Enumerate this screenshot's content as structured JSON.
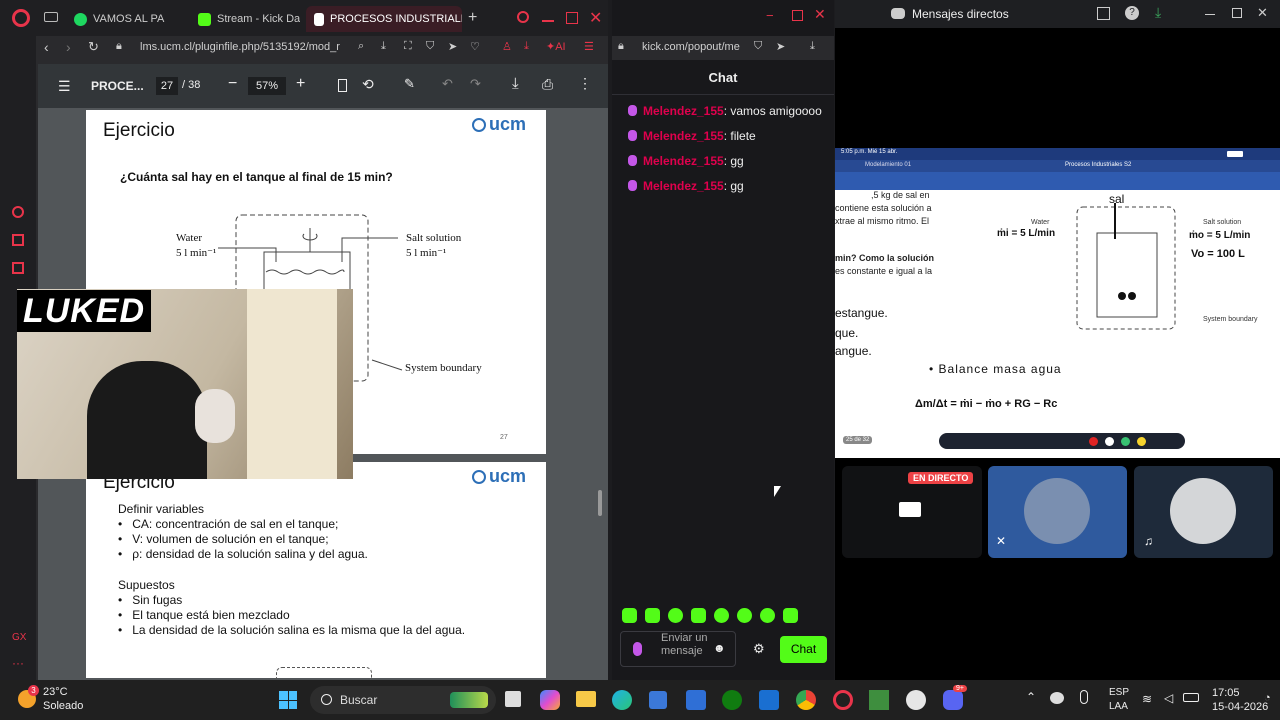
{
  "opera": {
    "tabs": [
      {
        "label": "VAMOS AL PA"
      },
      {
        "label": "Stream - Kick Da"
      },
      {
        "label": "PROCESOS INDUSTRIALE"
      }
    ],
    "address": "lms.ucm.cl/pluginfile.php/5135192/mod_r",
    "ai_label": "AI",
    "gx_label": "GX"
  },
  "pdf": {
    "title": "PROCE...",
    "page_current": "27",
    "page_total": "/ 38",
    "zoom": "57%"
  },
  "page1": {
    "heading": "Ejercicio",
    "logo": "ucm",
    "question": "¿Cuánta sal hay en el tanque al final de 15 min?",
    "water_label": "Water",
    "water_rate": "5 l min⁻¹",
    "salt_label": "Salt solution",
    "salt_rate": "5 l min⁻¹",
    "boundary_label": "System boundary",
    "page_number": "27"
  },
  "webcam": {
    "overlay": "LUKED"
  },
  "page2": {
    "heading": "Ejercicio",
    "logo": "ucm",
    "define_title": "Definir variables",
    "variables": [
      "CA: concentración de sal en el tanque;",
      "V: volumen de solución en el tanque;",
      "ρ: densidad de la solución salina y del agua."
    ],
    "assume_title": "Supuestos",
    "assumptions": [
      "Sin fugas",
      "El tanque está bien mezclado",
      "La densidad de la solución salina es la misma que la del agua."
    ]
  },
  "kick": {
    "address": "kick.com/popout/me",
    "header": "Chat",
    "messages": [
      {
        "user": "Melendez_155",
        "text": ": vamos amigoooo"
      },
      {
        "user": "Melendez_155",
        "text": ": filete"
      },
      {
        "user": "Melendez_155",
        "text": ": gg"
      },
      {
        "user": "Melendez_155",
        "text": ": gg"
      }
    ],
    "input_placeholder": "Enviar un mensaje",
    "send_label": "Chat",
    "user_color": "#e0004d",
    "accent": "#53fc18"
  },
  "discord": {
    "title": "Mensajes directos",
    "live_badge": "EN DIRECTO",
    "stream": {
      "status_time": "5:05 p.m.  Mié 15 abr.",
      "tab1": "Modelamiento 01",
      "tab2": "Procesos Industriales S2",
      "text_lines": [
        ",5 kg de sal en",
        "contiene esta solución a",
        "xtrae al mismo ritmo. El"
      ],
      "text_lines2": [
        "min? Como la solución",
        "es constante e igual a la"
      ],
      "left_words": [
        "estangue.",
        "que.",
        "angue."
      ],
      "hw_sal": "sal",
      "hw_mi": "ṁi = 5 L/min",
      "hw_mo": "ṁo = 5 L/min",
      "hw_vo": "Vo = 100 L",
      "hw_balance": "• Balance masa agua",
      "hw_eq": "Δm/Δt = ṁi − ṁo + RG − Rc",
      "water": "Water",
      "salt": "Salt solution",
      "boundary": "System boundary",
      "page_ind": "25 de 32"
    }
  },
  "taskbar": {
    "weather_temp": "23°C",
    "weather_desc": "Soleado",
    "weather_badge": "3",
    "search": "Buscar",
    "lang1": "ESP",
    "lang2": "LAA",
    "time": "17:05",
    "date": "15-04-2026",
    "discord_badge": "9+"
  }
}
